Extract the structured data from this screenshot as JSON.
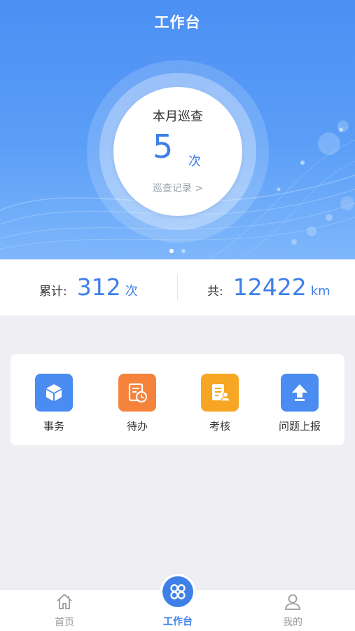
{
  "header": {
    "title": "工作台"
  },
  "monthly": {
    "label": "本月巡查",
    "count": "5",
    "unit": "次",
    "link": "巡查记录 >"
  },
  "carousel": {
    "pages": 2,
    "active": 1
  },
  "stats": {
    "total_label": "累计:",
    "total_value": "312",
    "total_unit": "次",
    "distance_label": "共:",
    "distance_value": "12422",
    "distance_unit": "km"
  },
  "functions": [
    {
      "label": "事务",
      "icon": "cube-icon",
      "color": "#4a8cf2"
    },
    {
      "label": "待办",
      "icon": "todo-clock-icon",
      "color": "#f5833c"
    },
    {
      "label": "考核",
      "icon": "assessment-icon",
      "color": "#f6a623"
    },
    {
      "label": "问题上报",
      "icon": "upload-arrow-icon",
      "color": "#4a8cf2"
    }
  ],
  "tabbar": {
    "home": "首页",
    "workbench": "工作台",
    "mine": "我的"
  },
  "colors": {
    "accent": "#3f7fe8",
    "hero_top": "#4c8ff4",
    "hero_bottom": "#7fb7fb",
    "page_bg": "#efeff3"
  }
}
